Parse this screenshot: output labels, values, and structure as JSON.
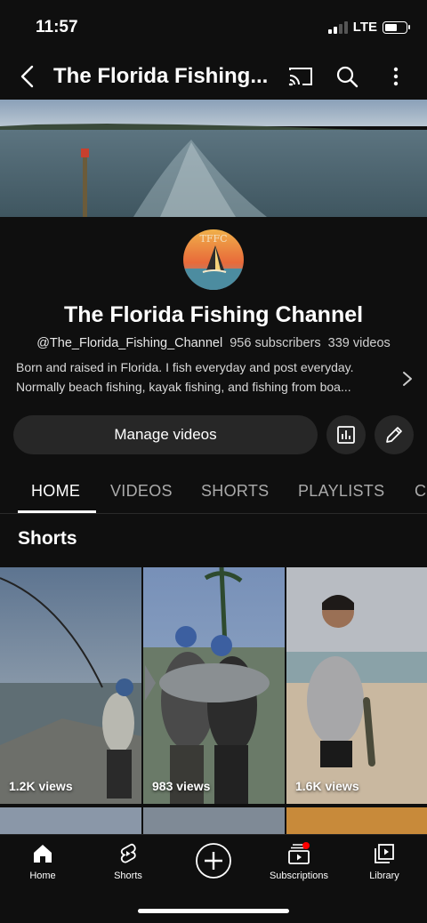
{
  "status": {
    "time": "11:57",
    "network": "LTE",
    "signal_bars": 2,
    "battery_level": 0.6
  },
  "header": {
    "title": "The Florida Fishing...",
    "back_icon": "chevron-left-icon",
    "actions": [
      "cast-icon",
      "search-icon",
      "more-vert-icon"
    ]
  },
  "channel": {
    "avatar_text": "TFFC",
    "name": "The Florida Fishing Channel",
    "handle": "@The_Florida_Fishing_Channel",
    "subscribers": "956 subscribers",
    "videos": "339 videos",
    "description_line1": "Born and raised in Florida. I fish everyday and post everyday.",
    "description_line2": "Normally beach fishing, kayak fishing, and fishing from boa..."
  },
  "actions": {
    "manage_label": "Manage videos",
    "analytics_icon": "analytics-icon",
    "edit_icon": "pencil-icon"
  },
  "tabs": [
    {
      "label": "HOME",
      "active": true
    },
    {
      "label": "VIDEOS",
      "active": false
    },
    {
      "label": "SHORTS",
      "active": false
    },
    {
      "label": "PLAYLISTS",
      "active": false
    },
    {
      "label": "C",
      "active": false
    }
  ],
  "shorts_section": {
    "title": "Shorts",
    "items": [
      {
        "views": "1.2K views"
      },
      {
        "views": "983 views"
      },
      {
        "views": "1.6K views"
      }
    ]
  },
  "bottom_nav": [
    {
      "label": "Home",
      "icon": "home-icon"
    },
    {
      "label": "Shorts",
      "icon": "shorts-icon"
    },
    {
      "label": "",
      "icon": "create-plus-icon"
    },
    {
      "label": "Subscriptions",
      "icon": "subscriptions-icon"
    },
    {
      "label": "Library",
      "icon": "library-icon"
    }
  ],
  "colors": {
    "background": "#0f0f0f",
    "chip": "#272727",
    "notification_dot": "#ff0000"
  }
}
